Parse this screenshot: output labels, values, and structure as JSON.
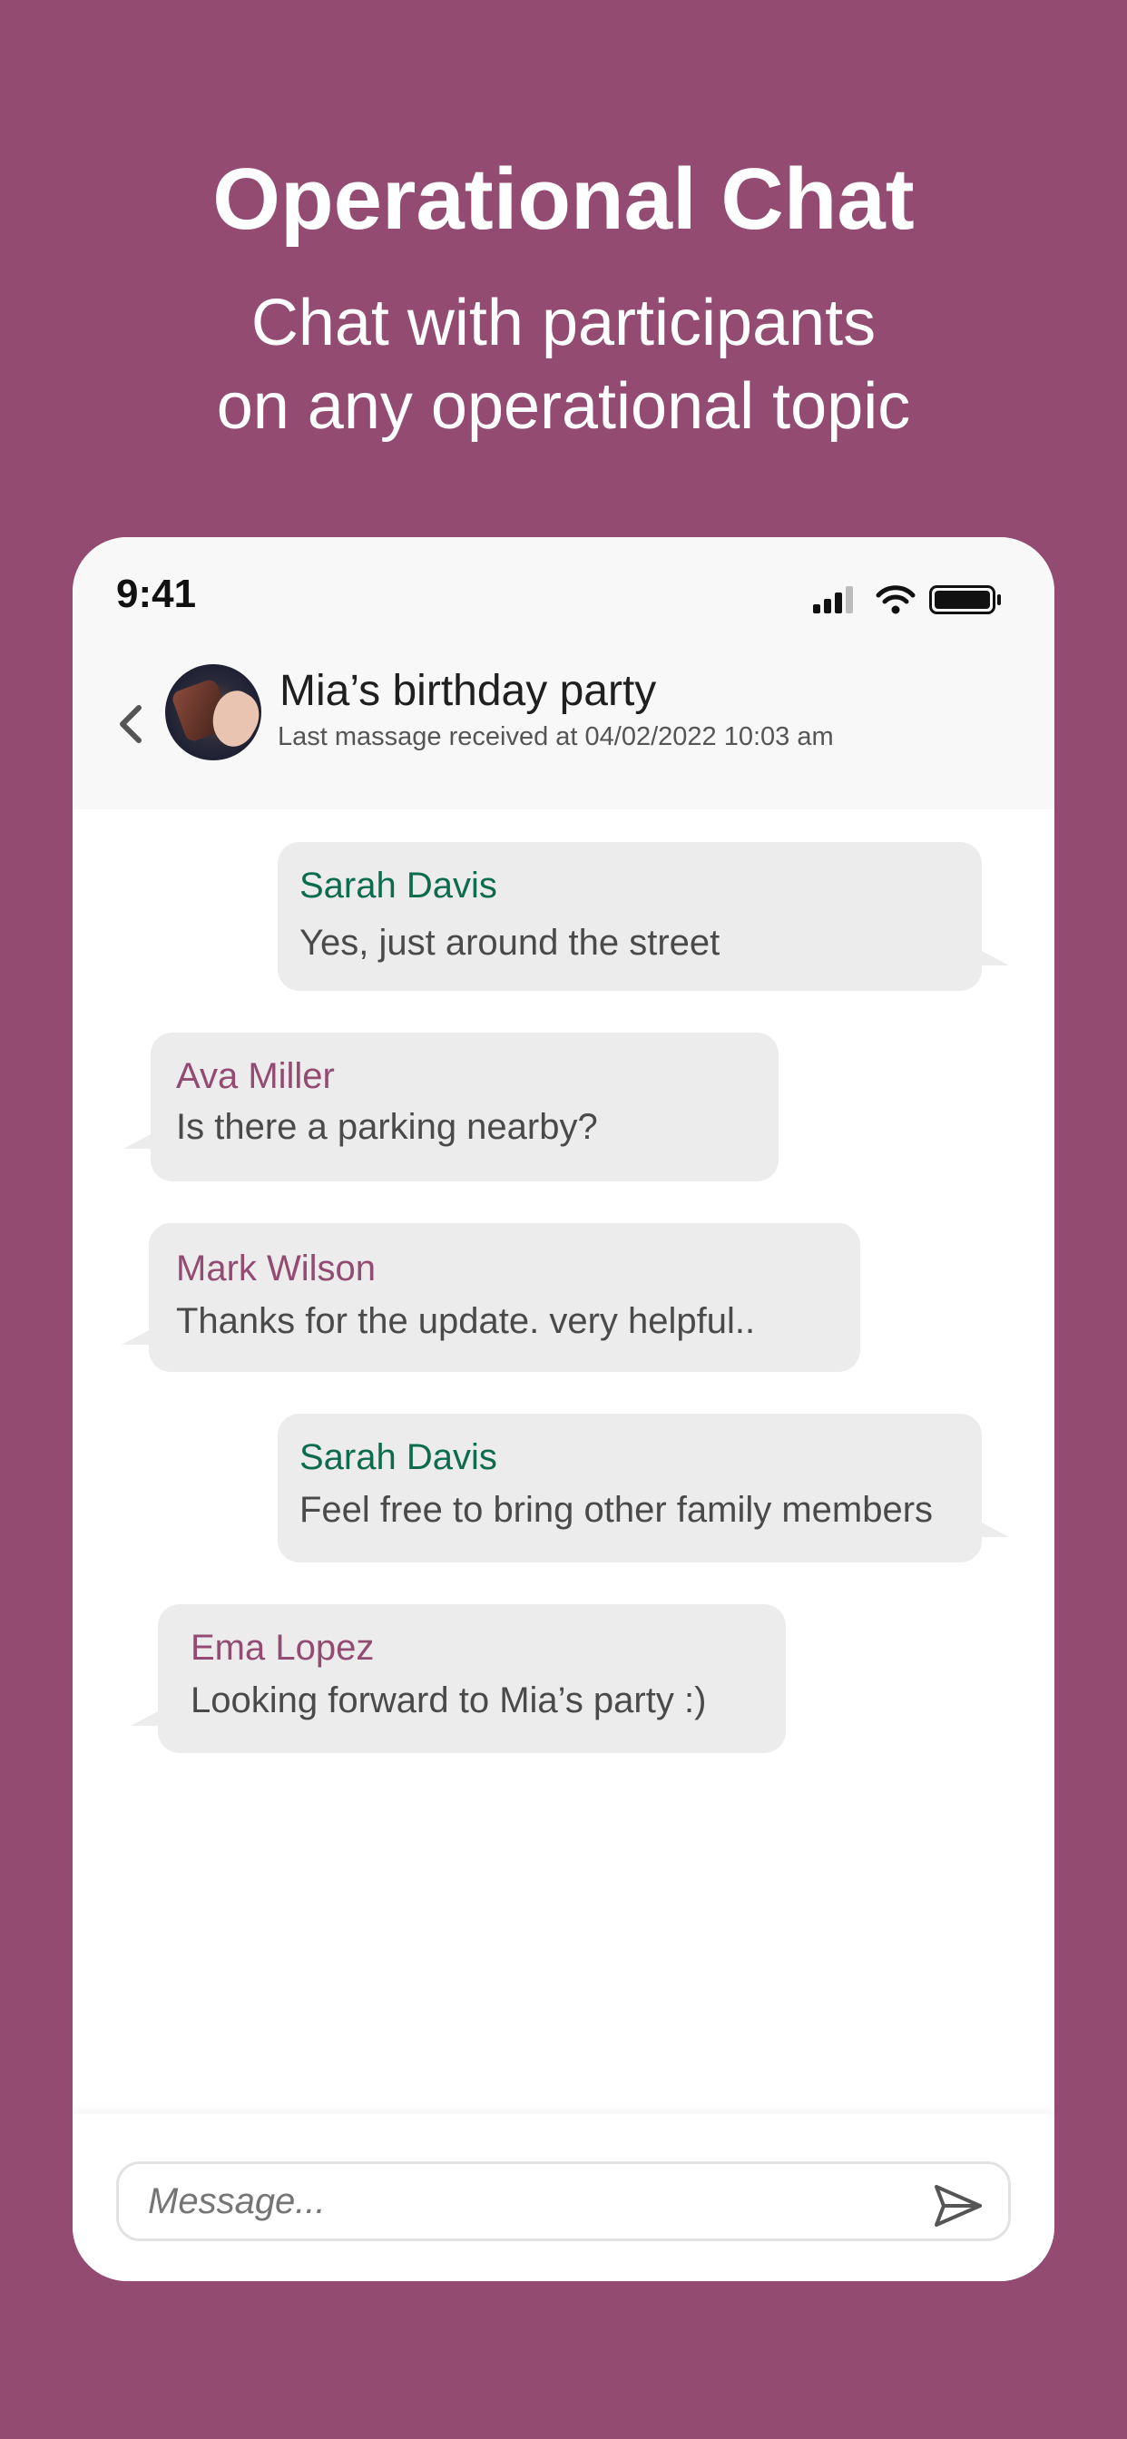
{
  "hero": {
    "title": "Operational Chat",
    "subtitle_line1": "Chat with participants",
    "subtitle_line2": "on any operational topic"
  },
  "status_bar": {
    "time": "9:41"
  },
  "chat_header": {
    "title": "Mia’s birthday party",
    "subtitle": "Last massage received at 04/02/2022 10:03 am"
  },
  "messages": [
    {
      "sender": "Sarah Davis",
      "text": "Yes, just around the street",
      "direction": "outgoing"
    },
    {
      "sender": "Ava Miller",
      "text": "Is there a parking nearby?",
      "direction": "incoming"
    },
    {
      "sender": "Mark Wilson",
      "text": "Thanks for the update. very helpful..",
      "direction": "incoming"
    },
    {
      "sender": "Sarah Davis",
      "text": "Feel free to bring other family members",
      "direction": "outgoing"
    },
    {
      "sender": "Ema Lopez",
      "text": "Looking forward to Mia’s party :)",
      "direction": "incoming"
    }
  ],
  "composer": {
    "placeholder": "Message..."
  },
  "colors": {
    "background": "#944b72",
    "outgoing_name": "#0d6b4e",
    "incoming_name": "#944b72",
    "bubble": "#ececec"
  },
  "icons": [
    "back-chevron-icon",
    "signal-icon",
    "wifi-icon",
    "battery-icon",
    "send-icon"
  ]
}
